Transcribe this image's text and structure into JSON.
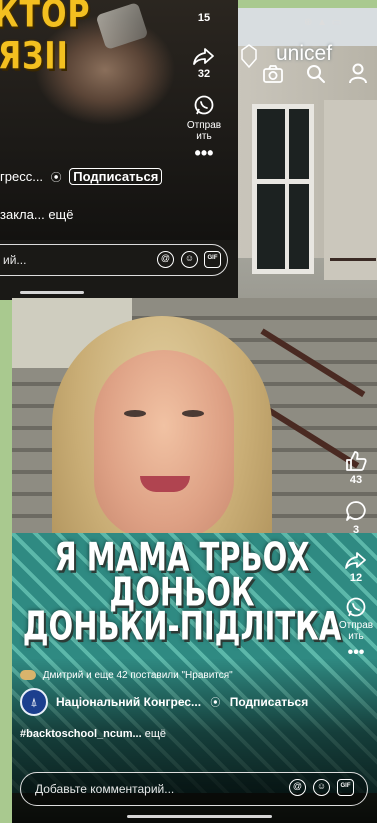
{
  "top_reel": {
    "title_line1": "КТОР",
    "title_line2": "ЯЗІІ",
    "rail": {
      "like_count": "15",
      "share_count": "32",
      "send_label_line1": "Отправ",
      "send_label_line2": "ить"
    },
    "author_name": "гресс...",
    "follow_label": "Подписаться",
    "caption": "закла...",
    "caption_more": "ещё",
    "comment_placeholder": "ий..."
  },
  "building": {
    "status_icons": "⊕ ▲ ▭",
    "logo_text": "unicef"
  },
  "bottom_reel": {
    "headline_line1": "Я МАМА ТРЬОХ",
    "headline_line2": "ДОНЬОК",
    "headline_line3": "ДОНЬКИ-ПІДЛІТКА",
    "rail": {
      "like_count": "43",
      "comment_count": "3",
      "share_count": "12",
      "send_label_line1": "Отправ",
      "send_label_line2": "ить"
    },
    "likes_text": "Дмитрий и еще 42 поставили \"Нравится\"",
    "author_name": "Національний Конгрес...",
    "follow_label": "Подписаться",
    "caption": "#backtoschool_ncum...",
    "caption_more": "ещё",
    "comment_placeholder": "Добавьте комментарий..."
  },
  "colors": {
    "page_background": "#a9c98f",
    "title_yellow": "#f3c020",
    "blouse_teal": "#3b9a8e"
  }
}
